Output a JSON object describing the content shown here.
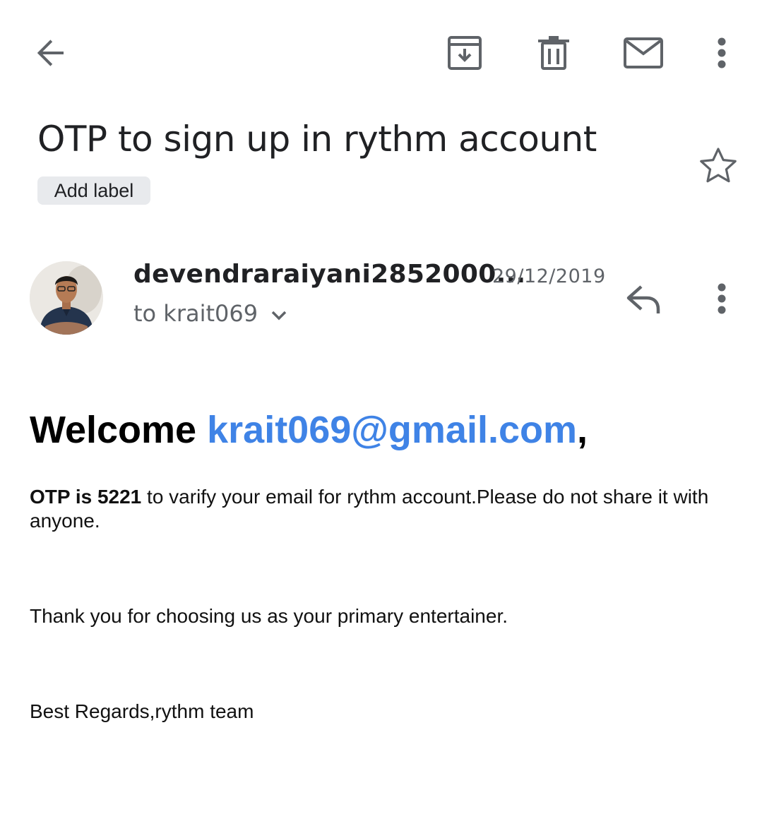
{
  "toolbar": {
    "back_icon": "arrow-back-icon",
    "archive_icon": "archive-icon",
    "delete_icon": "trash-icon",
    "mark_unread_icon": "mail-icon",
    "more_icon": "more-vert-icon"
  },
  "email": {
    "subject": "OTP to sign up in rythm account",
    "add_label": "Add label",
    "starred": false,
    "sender": "devendraraiyani2852000...",
    "date": "29/12/2019",
    "recipient": "to krait069",
    "avatar_icon": "sender-avatar"
  },
  "body": {
    "welcome_prefix": "Welcome ",
    "welcome_email": "krait069@gmail.com",
    "welcome_suffix": ",",
    "otp_bold": "OTP is 5221",
    "otp_rest": " to varify your email for rythm account.Please do not share it with anyone.",
    "thanks": "Thank you for choosing us as your primary entertainer.",
    "regards": "Best Regards,rythm team"
  },
  "colors": {
    "link": "#3f83e6",
    "icon": "#5f6368",
    "chip": "#e8eaed"
  }
}
